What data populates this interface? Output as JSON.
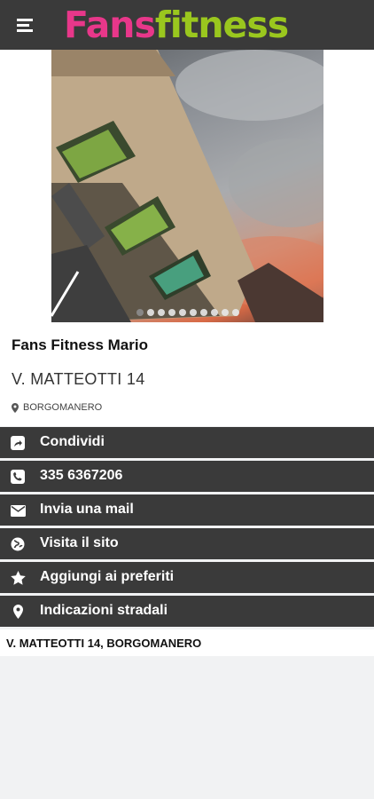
{
  "header": {
    "logo_part1": "Fans",
    "logo_part2": "fitness",
    "menu_icon": "hamburger-menu-icon",
    "colors": {
      "bar": "#3a3a3a",
      "logo_pink": "#e8378a",
      "logo_green": "#9ac71e"
    }
  },
  "gallery": {
    "slides": 10,
    "active_index": 0
  },
  "place": {
    "name": "Fans Fitness Mario",
    "address": "V. MATTEOTTI 14",
    "city": "BORGOMANERO",
    "city_icon": "map-pin-icon"
  },
  "actions": [
    {
      "label": "Condividi",
      "icon": "share-icon"
    },
    {
      "label": "335 6367206",
      "icon": "phone-icon"
    },
    {
      "label": "Invia una mail",
      "icon": "mail-icon"
    },
    {
      "label": "Visita il sito",
      "icon": "globe-icon"
    },
    {
      "label": "Aggiungi ai preferiti",
      "icon": "star-icon"
    },
    {
      "label": "Indicazioni stradali",
      "icon": "map-pin-icon"
    }
  ],
  "footer": {
    "full_address": "V. MATTEOTTI 14, BORGOMANERO"
  }
}
